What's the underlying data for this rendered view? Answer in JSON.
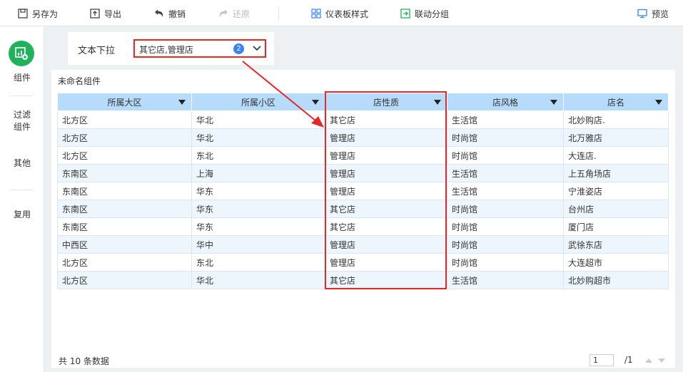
{
  "toolbar": {
    "save_as": "另存为",
    "export": "导出",
    "undo": "撤销",
    "redo": "还原",
    "dashboard_style": "仪表板样式",
    "linkage_group": "联动分组",
    "preview": "预览"
  },
  "sidebar": {
    "items": [
      {
        "label": "组件"
      },
      {
        "label": "过滤\n组件"
      },
      {
        "label": "其他"
      },
      {
        "label": "复用"
      }
    ]
  },
  "filter": {
    "label": "文本下拉",
    "value": "其它店,管理店",
    "count": "2"
  },
  "table": {
    "title": "未命名组件",
    "columns": [
      "所属大区",
      "所属小区",
      "店性质",
      "店风格",
      "店名"
    ],
    "rows": [
      [
        "北方区",
        "华北",
        "其它店",
        "生活馆",
        "北妙购店."
      ],
      [
        "北方区",
        "华北",
        "管理店",
        "时尚馆",
        "北万雅店"
      ],
      [
        "北方区",
        "东北",
        "管理店",
        "时尚馆",
        "大连店."
      ],
      [
        "东南区",
        "上海",
        "管理店",
        "生活馆",
        "上五角场店"
      ],
      [
        "东南区",
        "华东",
        "管理店",
        "生活馆",
        "宁淮姿店"
      ],
      [
        "东南区",
        "华东",
        "其它店",
        "时尚馆",
        "台州店"
      ],
      [
        "东南区",
        "华东",
        "其它店",
        "时尚馆",
        "厦门店"
      ],
      [
        "中西区",
        "华中",
        "管理店",
        "时尚馆",
        "武徐东店"
      ],
      [
        "北方区",
        "东北",
        "管理店",
        "时尚馆",
        "大连超市"
      ],
      [
        "北方区",
        "华北",
        "其它店",
        "生活馆",
        "北妙购超市"
      ]
    ],
    "footer_count": "共 10 条数据",
    "page_current": "1",
    "page_total": "/1"
  },
  "colors": {
    "header_bg": "#b6dbfb",
    "highlight": "#e5282a",
    "accent_green": "#1fb25a",
    "badge": "#3685f2"
  }
}
